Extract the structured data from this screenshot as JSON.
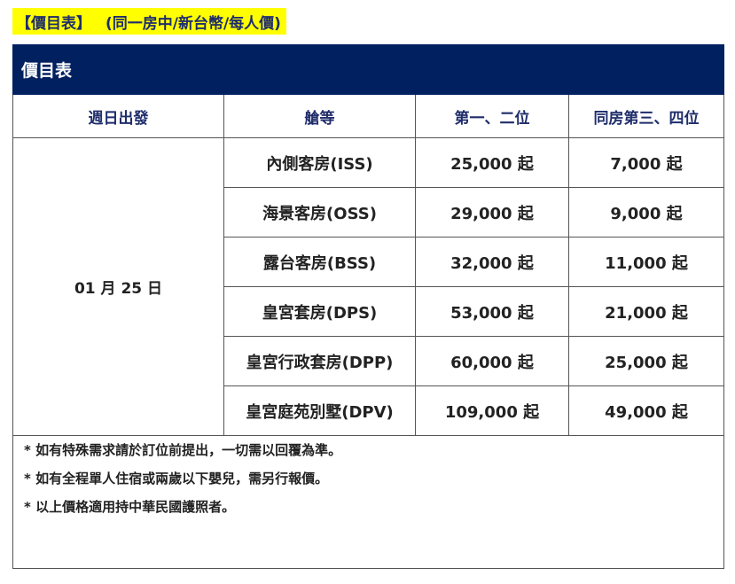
{
  "heading": {
    "title": "【價目表】",
    "subtitle": "(同一房中/新台幣/每人價)"
  },
  "table": {
    "title": "價目表",
    "columns": [
      "週日出發",
      "艙等",
      "第一、二位",
      "同房第三、四位"
    ],
    "departure_date": "01 月 25 日",
    "rows": [
      {
        "cabin": "內側客房(ISS)",
        "first_second": "25,000 起",
        "third_fourth": "7,000 起"
      },
      {
        "cabin": "海景客房(OSS)",
        "first_second": "29,000 起",
        "third_fourth": "9,000 起"
      },
      {
        "cabin": "露台客房(BSS)",
        "first_second": "32,000 起",
        "third_fourth": "11,000 起"
      },
      {
        "cabin": "皇宮套房(DPS)",
        "first_second": "53,000 起",
        "third_fourth": "21,000 起"
      },
      {
        "cabin": "皇宮行政套房(DPP)",
        "first_second": "60,000 起",
        "third_fourth": "25,000 起"
      },
      {
        "cabin": "皇宮庭苑別墅(DPV)",
        "first_second": "109,000 起",
        "third_fourth": "49,000 起"
      }
    ]
  },
  "notes": [
    "* 如有特殊需求請於訂位前提出，一切需以回覆為準。",
    "* 如有全程單人住宿或兩歲以下嬰兒，需另行報價。",
    "* 以上價格適用持中華民國護照者。"
  ],
  "colors": {
    "header_bg": "#002060",
    "highlight": "#ffff00",
    "heading_text": "#1f2d6b"
  }
}
